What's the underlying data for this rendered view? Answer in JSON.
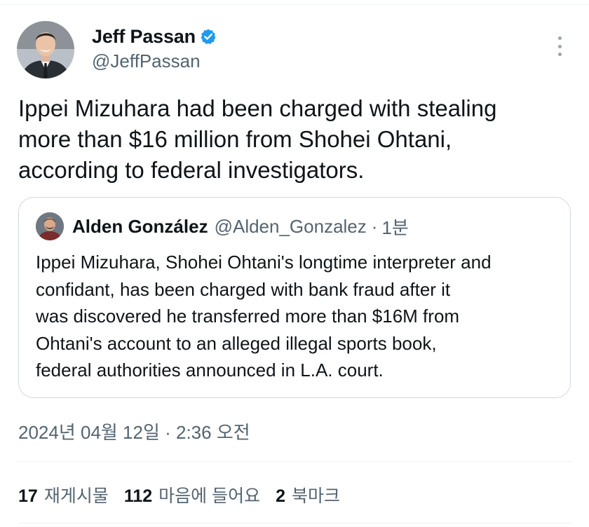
{
  "author": {
    "display_name": "Jeff Passan",
    "handle": "@JeffPassan",
    "verified": true,
    "avatar_icon": "profile-photo-icon"
  },
  "tweet": {
    "lines": [
      "Ippei Mizuhara had been charged with stealing",
      "more than $16 million from Shohei Ohtani,",
      "according to federal investigators."
    ]
  },
  "quote": {
    "display_name": "Alden González",
    "handle": "@Alden_Gonzalez",
    "separator": "·",
    "time": "1분",
    "lines": [
      "Ippei Mizuhara, Shohei Ohtani's longtime interpreter and",
      "confidant, has been charged with bank fraud after it",
      "was discovered he transferred more than $16M from",
      "Ohtani's account to an alleged illegal sports book,",
      "federal authorities announced in L.A. court."
    ]
  },
  "timestamp": "2024년 04월 12일 · 2:36 오전",
  "stats": {
    "reposts": {
      "count": "17",
      "label": "재게시물"
    },
    "likes": {
      "count": "112",
      "label": "마음에 들어요"
    },
    "bookmarks": {
      "count": "2",
      "label": "북마크"
    }
  },
  "colors": {
    "verified_badge": "#1d9bf0",
    "secondary_text": "#536471",
    "primary_text": "#0f1419",
    "border": "#cfd9de"
  }
}
